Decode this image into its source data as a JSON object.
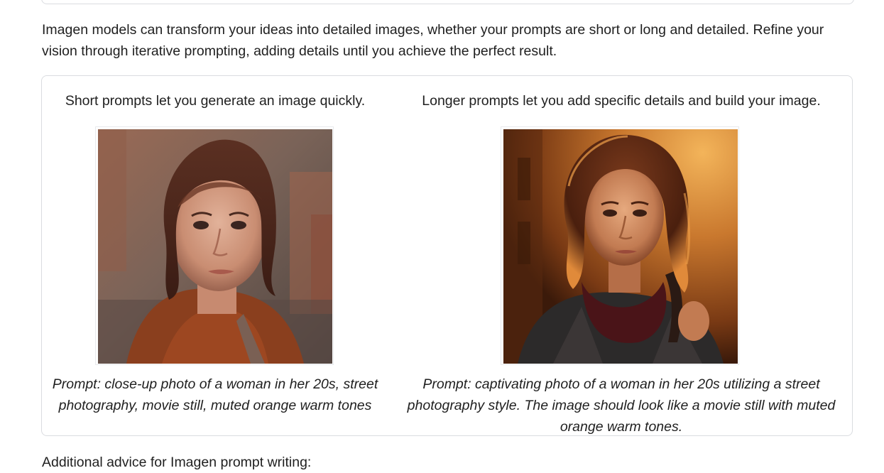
{
  "intro": {
    "text": "Imagen models can transform your ideas into detailed images, whether your prompts are short or long and detailed. Refine your vision through iterative prompting, adding details until you achieve the perfect result."
  },
  "comparison": {
    "short": {
      "heading": "Short prompts let you generate an image quickly.",
      "caption": "Prompt: close-up photo of a woman in her 20s, street photography, movie still, muted orange warm tones"
    },
    "long": {
      "heading": "Longer prompts let you add specific details and build your image.",
      "caption": "Prompt: captivating photo of a woman in her 20s utilizing a street photography style. The image should look like a movie still with muted orange warm tones."
    }
  },
  "advice": {
    "text": "Additional advice for Imagen prompt writing:"
  }
}
